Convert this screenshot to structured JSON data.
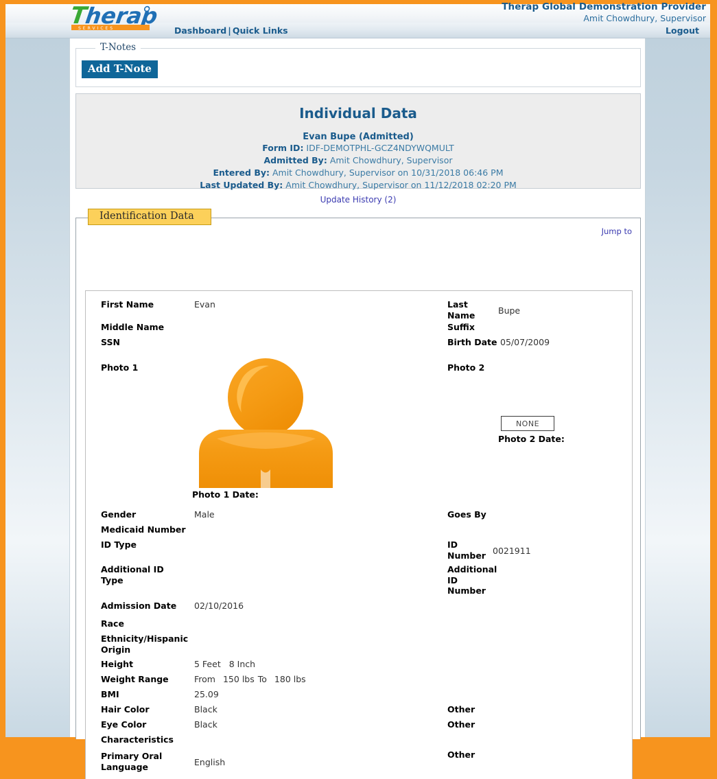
{
  "header": {
    "logo_alt": "Therap Services",
    "provider": "Therap Global Demonstration Provider",
    "user": "Amit Chowdhury, Supervisor",
    "nav": {
      "dashboard": "Dashboard",
      "separator": "|",
      "quick_links": "Quick Links",
      "logout": "Logout"
    }
  },
  "tnotes": {
    "legend": "T-Notes",
    "add_button": "Add T-Note"
  },
  "individual_data": {
    "title": "Individual Data",
    "subject": "Evan Bupe (Admitted)",
    "form_id_label": "Form ID:",
    "form_id_value": "IDF-DEMOTPHL-GCZ4NDYWQMULT",
    "admitted_by_label": "Admitted By:",
    "admitted_by_value": "Amit Chowdhury, Supervisor",
    "entered_by_label": "Entered By:",
    "entered_by_value": "Amit Chowdhury, Supervisor on 10/31/2018 06:46 PM",
    "last_updated_by_label": "Last Updated By:",
    "last_updated_by_value": "Amit Chowdhury, Supervisor on 11/12/2018 02:20 PM"
  },
  "update_history": "Update History (2)",
  "section": {
    "legend": "Identification Data",
    "jump_to": "Jump to"
  },
  "fields": {
    "first_name_label": "First Name",
    "first_name_value": "Evan",
    "middle_name_label": "Middle Name",
    "middle_name_value": "",
    "ssn_label": "SSN",
    "ssn_value": "",
    "last_name_label": "Last Name",
    "last_name_value": "Bupe",
    "suffix_label": "Suffix",
    "suffix_value": "",
    "birth_date_label": "Birth Date",
    "birth_date_value": "05/07/2009",
    "photo1_label": "Photo 1",
    "photo1_date_label": "Photo 1 Date:",
    "photo1_date_value": "",
    "photo2_label": "Photo 2",
    "photo2_none": "NONE",
    "photo2_date_label": "Photo 2 Date:",
    "photo2_date_value": "",
    "gender_label": "Gender",
    "gender_value": "Male",
    "medicaid_number_label": "Medicaid Number",
    "medicaid_number_value": "",
    "id_type_label": "ID Type",
    "id_type_value": "",
    "additional_id_type_label": "Additional ID Type",
    "additional_id_type_value": "",
    "goes_by_label": "Goes By",
    "goes_by_value": "",
    "id_number_label": "ID Number",
    "id_number_value": "0021911",
    "additional_id_number_label": "Additional ID Number",
    "additional_id_number_value": "",
    "admission_date_label": "Admission Date",
    "admission_date_value": "02/10/2016",
    "race_label": "Race",
    "race_value": "",
    "ethnicity_label": "Ethnicity/Hispanic Origin",
    "ethnicity_value": "",
    "height_label": "Height",
    "height_feet": "5 Feet",
    "height_inch": "8 Inch",
    "weight_range_label": "Weight Range",
    "weight_from_label": "From",
    "weight_from_value": "150 lbs",
    "weight_to_label": "To",
    "weight_to_value": "180 lbs",
    "bmi_label": "BMI",
    "bmi_value": "25.09",
    "hair_color_label": "Hair Color",
    "hair_color_value": "Black",
    "hair_other_label": "Other",
    "eye_color_label": "Eye Color",
    "eye_color_value": "Black",
    "eye_other_label": "Other",
    "characteristics_label": "Characteristics",
    "characteristics_value": "",
    "primary_oral_language_label": "Primary Oral Language",
    "primary_oral_language_value": "English",
    "language_other_label": "Other"
  },
  "colors": {
    "brand_orange": "#f7941e",
    "brand_blue": "#1a5b8c",
    "button_blue": "#0f6699",
    "legend_gold": "#fcd05a",
    "link_violet": "#3a3ab0",
    "avatar_orange": "#f59b14"
  }
}
